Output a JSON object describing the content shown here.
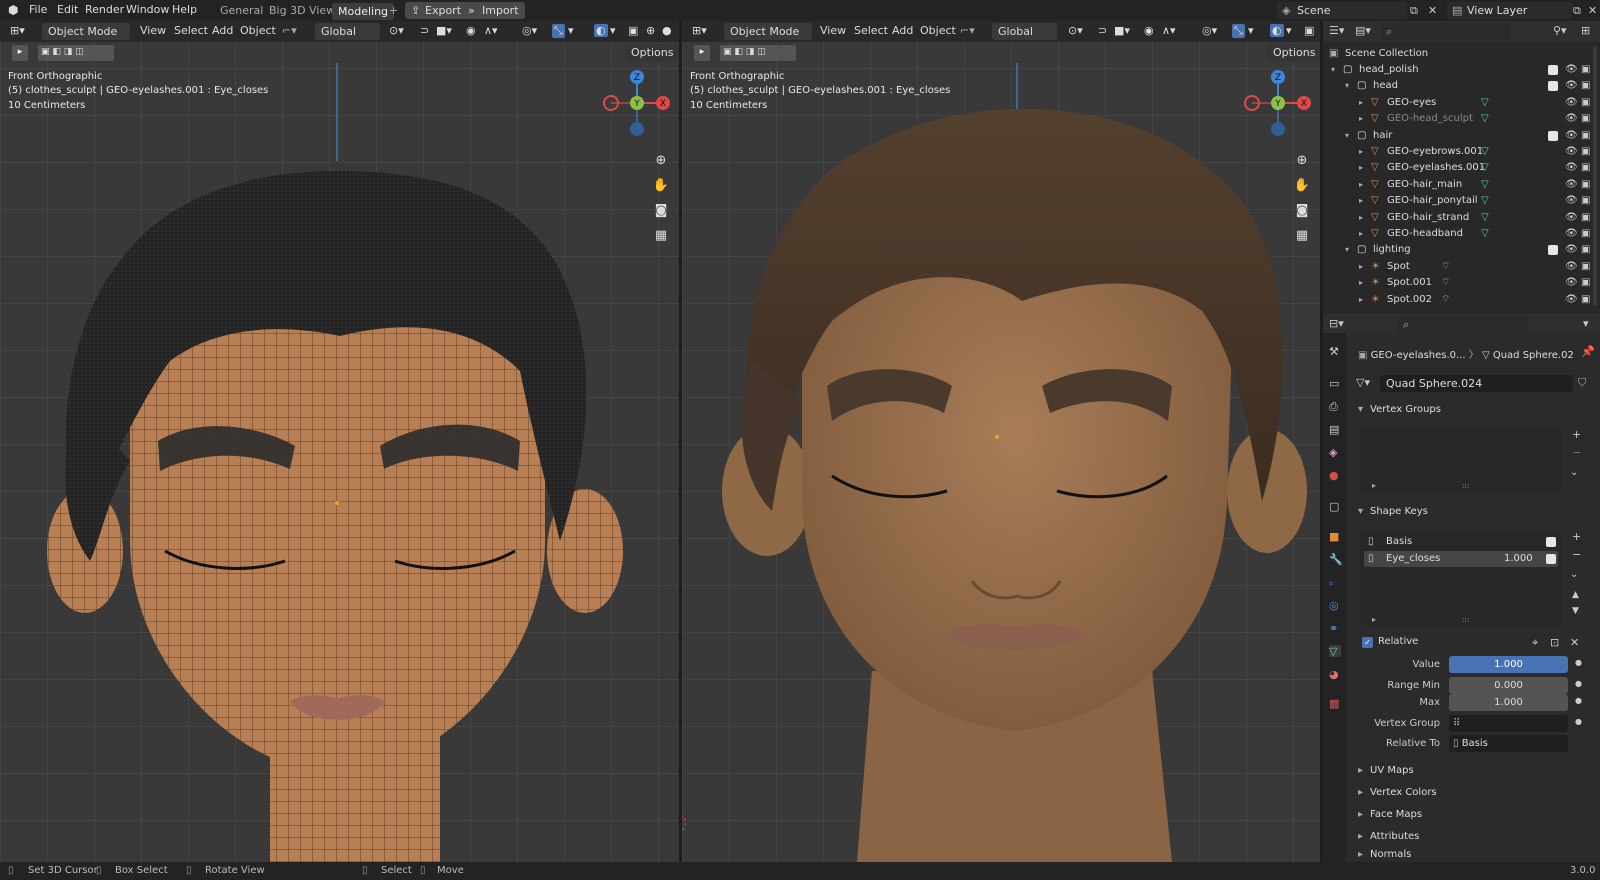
{
  "topbar": {
    "menus": [
      "File",
      "Edit",
      "Render",
      "Window",
      "Help"
    ],
    "workspaces": [
      "General",
      "Big 3D View",
      "Modeling"
    ],
    "active_workspace": "Modeling",
    "add_tab": "+",
    "export_label": "Export",
    "import_label": "Import",
    "scene_label": "Scene",
    "view_layer_label": "View Layer"
  },
  "viewport_left": {
    "mode": "Object Mode",
    "menus": [
      "View",
      "Select",
      "Add",
      "Object"
    ],
    "transform": "Global",
    "options": "Options",
    "info_line1": "Front Orthographic",
    "info_line2": "(5) clothes_sculpt | GEO-eyelashes.001 : Eye_closes",
    "info_line3": "10 Centimeters",
    "gizmo": {
      "z": "Z",
      "y": "Y",
      "x": "X"
    }
  },
  "viewport_right": {
    "mode": "Object Mode",
    "menus": [
      "View",
      "Select",
      "Add",
      "Object"
    ],
    "transform": "Global",
    "options": "Options",
    "info_line1": "Front Orthographic",
    "info_line2": "(5) clothes_sculpt | GEO-eyelashes.001 : Eye_closes",
    "info_line3": "10 Centimeters",
    "gizmo": {
      "z": "Z",
      "y": "Y",
      "x": "X"
    }
  },
  "outliner": {
    "root": "Scene Collection",
    "items": [
      {
        "label": "head_polish",
        "type": "collection"
      },
      {
        "label": "head",
        "type": "collection"
      },
      {
        "label": "GEO-eyes",
        "type": "mesh"
      },
      {
        "label": "GEO-head_sculpt",
        "type": "mesh"
      },
      {
        "label": "hair",
        "type": "collection"
      },
      {
        "label": "GEO-eyebrows.001",
        "type": "mesh"
      },
      {
        "label": "GEO-eyelashes.001",
        "type": "mesh"
      },
      {
        "label": "GEO-hair_main",
        "type": "mesh"
      },
      {
        "label": "GEO-hair_ponytail",
        "type": "mesh"
      },
      {
        "label": "GEO-hair_strand",
        "type": "mesh"
      },
      {
        "label": "GEO-headband",
        "type": "mesh"
      },
      {
        "label": "lighting",
        "type": "collection"
      },
      {
        "label": "Spot",
        "type": "light"
      },
      {
        "label": "Spot.001",
        "type": "light"
      },
      {
        "label": "Spot.002",
        "type": "light"
      }
    ]
  },
  "properties": {
    "breadcrumb_object": "GEO-eyelashes.0...",
    "breadcrumb_data": "Quad Sphere.02",
    "mesh_name": "Quad Sphere.024",
    "vertex_groups": "Vertex Groups",
    "shape_keys": "Shape Keys",
    "shape_key_items": [
      {
        "name": "Basis",
        "value": ""
      },
      {
        "name": "Eye_closes",
        "value": "1.000"
      }
    ],
    "relative_label": "Relative",
    "value_label": "Value",
    "value": "1.000",
    "range_min_label": "Range Min",
    "range_min": "0.000",
    "max_label": "Max",
    "max": "1.000",
    "vertex_group_label": "Vertex Group",
    "relative_to_label": "Relative To",
    "relative_to": "Basis",
    "closed_panels": [
      "UV Maps",
      "Vertex Colors",
      "Face Maps",
      "Attributes",
      "Normals"
    ]
  },
  "statusbar": {
    "items": [
      "Set 3D Cursor",
      "Box Select",
      "Rotate View",
      "Select",
      "Move"
    ],
    "version": "3.0.0"
  },
  "colors": {
    "accent": "#4772b3",
    "axis_x": "#e04848",
    "axis_y": "#8bc34a",
    "axis_z": "#3f85d6",
    "mesh": "#e08a3c"
  }
}
